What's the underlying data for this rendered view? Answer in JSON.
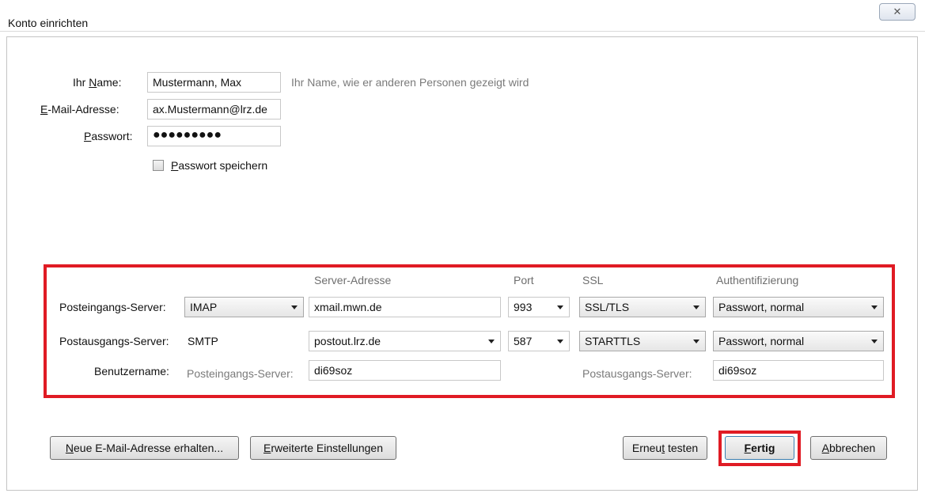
{
  "window": {
    "title": "Konto einrichten",
    "close_glyph": "✕"
  },
  "identity": {
    "name_label_pre": "Ihr ",
    "name_label_key": "N",
    "name_label_post": "ame:",
    "name_value": "Mustermann, Max",
    "name_hint": "Ihr Name, wie er anderen Personen gezeigt wird",
    "email_label_key": "E",
    "email_label_post": "-Mail-Adresse:",
    "email_value": "ax.Mustermann@lrz.de",
    "password_label_key": "P",
    "password_label_post": "asswort:",
    "password_value": "●●●●●●●●●",
    "save_password_key": "P",
    "save_password_post": "asswort speichern",
    "save_password_checked": false
  },
  "server": {
    "headers": {
      "address": "Server-Adresse",
      "port": "Port",
      "ssl": "SSL",
      "auth": "Authentifizierung"
    },
    "incoming": {
      "label": "Posteingangs-Server:",
      "protocol": "IMAP",
      "address": "xmail.mwn.de",
      "port": "993",
      "ssl": "SSL/TLS",
      "auth": "Passwort, normal"
    },
    "outgoing": {
      "label": "Postausgangs-Server:",
      "protocol": "SMTP",
      "address": "postout.lrz.de",
      "port": "587",
      "ssl": "STARTTLS",
      "auth": "Passwort, normal"
    },
    "username": {
      "label": "Benutzername:",
      "incoming_label": "Posteingangs-Server:",
      "incoming_value": "di69soz",
      "outgoing_label": "Postausgangs-Server:",
      "outgoing_value": "di69soz"
    }
  },
  "buttons": {
    "new_email_key": "N",
    "new_email_post": "eue E-Mail-Adresse erhalten...",
    "advanced_key": "E",
    "advanced_post": "rweiterte Einstellungen",
    "retest_pre": "Erneu",
    "retest_key": "t",
    "retest_post": " testen",
    "done_key": "F",
    "done_post": "ertig",
    "cancel_key": "A",
    "cancel_post": "bbrechen"
  },
  "colors": {
    "highlight": "#e01b24",
    "hint_text": "#7a7a7a"
  }
}
